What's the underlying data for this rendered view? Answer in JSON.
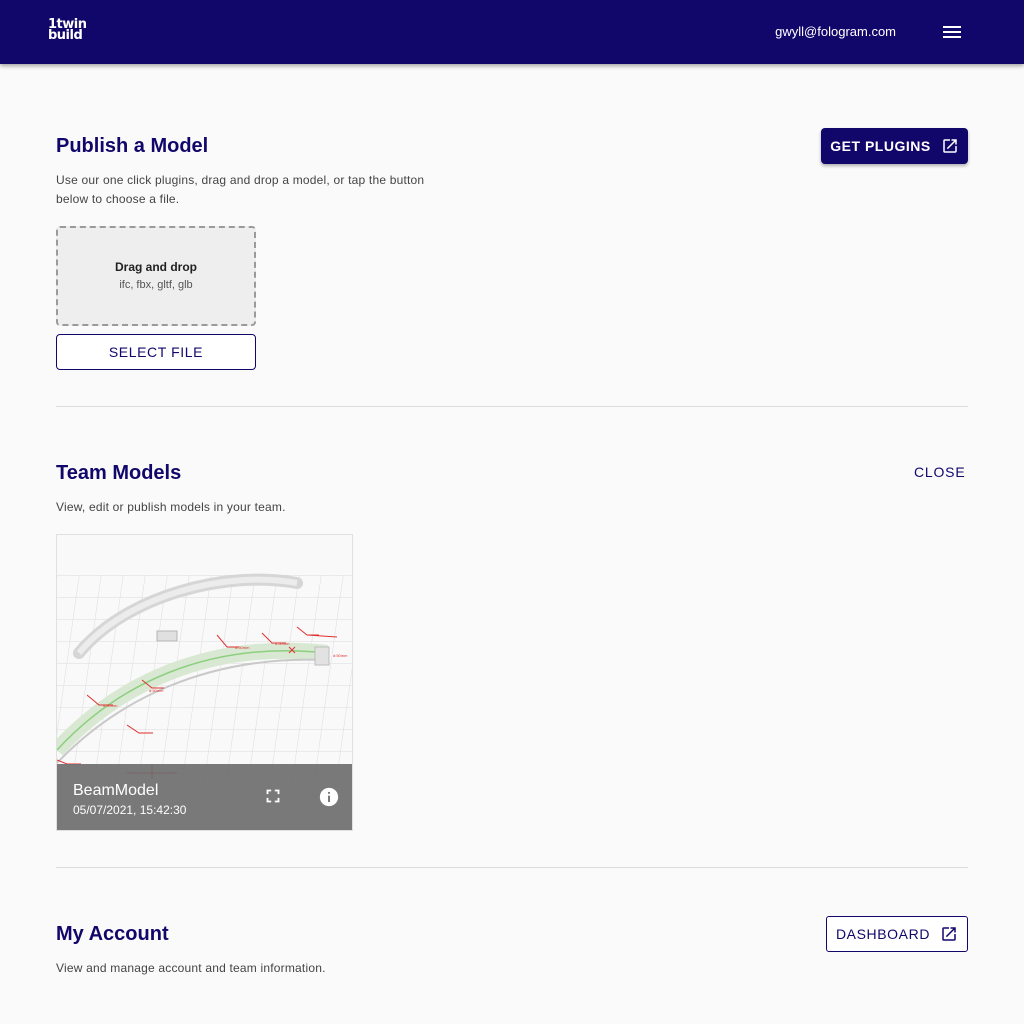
{
  "header": {
    "logo_line1": "1twin",
    "logo_line2": "build",
    "user_email": "gwyll@fologram.com"
  },
  "publish": {
    "title": "Publish a Model",
    "description_line1": "Use our one click plugins, drag and drop a model, or tap the button",
    "description_line2": "below to choose a file.",
    "get_plugins_label": "GET PLUGINS",
    "dropzone_title": "Drag and drop",
    "dropzone_formats": "ifc, fbx, gltf, glb",
    "select_file_label": "SELECT FILE"
  },
  "team": {
    "title": "Team Models",
    "description": "View, edit or publish models in your team.",
    "close_label": "CLOSE",
    "models": [
      {
        "name": "BeamModel",
        "date": "05/07/2021, 15:42:30"
      }
    ]
  },
  "account": {
    "title": "My Account",
    "description": "View and manage account and team information.",
    "dashboard_label": "DASHBOARD"
  },
  "colors": {
    "brand": "#11076b",
    "background": "#fafafa",
    "card_overlay": "#6e6e6e"
  },
  "icons": {
    "menu": "hamburger-menu-icon",
    "external_link": "external-link-icon",
    "fullscreen": "fullscreen-icon",
    "info": "info-icon"
  }
}
